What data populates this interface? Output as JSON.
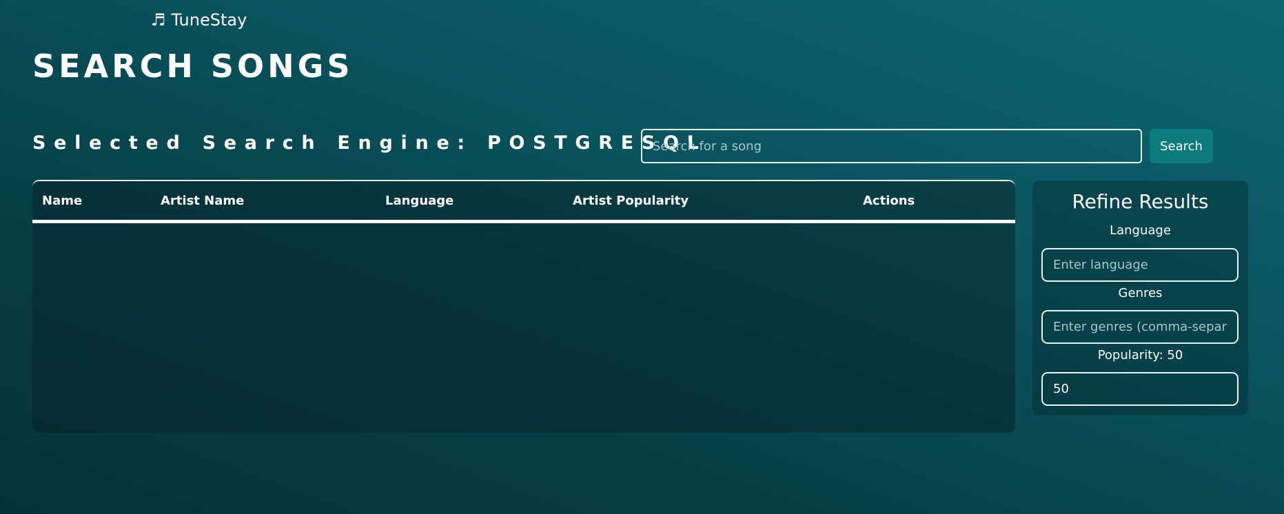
{
  "header": {
    "brand_icon": "music-note-icon",
    "brand_glyph": "♬",
    "brand_name": "TuneStay"
  },
  "page": {
    "title": "SEARCH SONGS",
    "engine_label": "Selected Search Engine: POSTGRESQL"
  },
  "search": {
    "placeholder": "Search for a song",
    "value": "",
    "button_label": "Search"
  },
  "table": {
    "columns": [
      "Name",
      "Artist Name",
      "Language",
      "Artist Popularity",
      "Actions"
    ],
    "rows": []
  },
  "refine": {
    "title": "Refine Results",
    "language_label": "Language",
    "language_placeholder": "Enter language",
    "genres_label": "Genres",
    "genres_placeholder": "Enter genres (comma-separated)",
    "popularity_label": "Popularity: 50",
    "popularity_value": "50"
  },
  "colors": {
    "background_top": "#0c6670",
    "background_bottom": "#04323a",
    "accent_button": "#0d7a7c",
    "text": "#ffffff"
  }
}
